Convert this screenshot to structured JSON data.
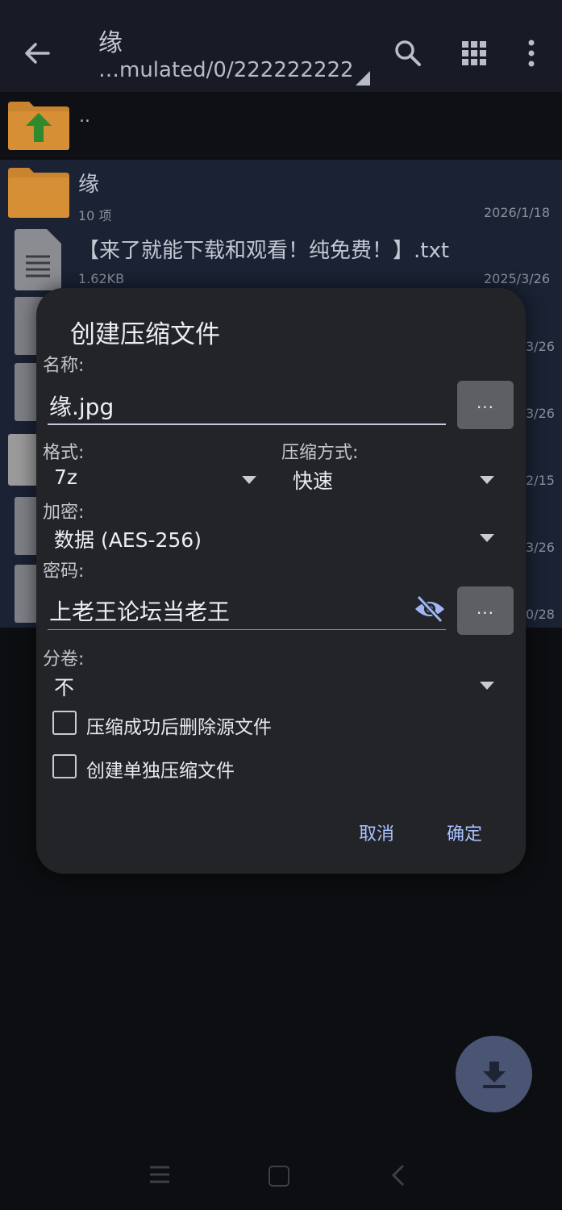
{
  "appbar": {
    "title": "缘",
    "path": "…mulated/0/222222222"
  },
  "parent_row": {
    "label": ".."
  },
  "files": [
    {
      "name": "缘",
      "meta": "10 项",
      "date": "2026/1/18"
    },
    {
      "name": "【来了就能下载和观看！纯免费！】.txt",
      "meta": "1.62KB",
      "date": "2025/3/26"
    }
  ],
  "peek_dates": [
    "3/26",
    "3/26",
    "2/15",
    "3/26",
    "0/28"
  ],
  "dialog": {
    "title": "创建压缩文件",
    "name_label": "名称:",
    "name_value": "缘.jpg",
    "ellipsis": "...",
    "format_label": "格式:",
    "format_value": "7z",
    "method_label": "压缩方式:",
    "method_value": "快速",
    "encrypt_label": "加密:",
    "encrypt_value": "数据 (AES-256)",
    "password_label": "密码:",
    "password_value": "上老王论坛当老王",
    "split_label": "分卷:",
    "split_value": "不",
    "option_delete": "压缩成功后删除源文件",
    "option_separate": "创建单独压缩文件",
    "cancel": "取消",
    "ok": "确定"
  },
  "colors": {
    "accent": "#a8c1ff",
    "dialog_bg": "#222428",
    "folder": "#d3892e",
    "fab": "#4a5574"
  }
}
